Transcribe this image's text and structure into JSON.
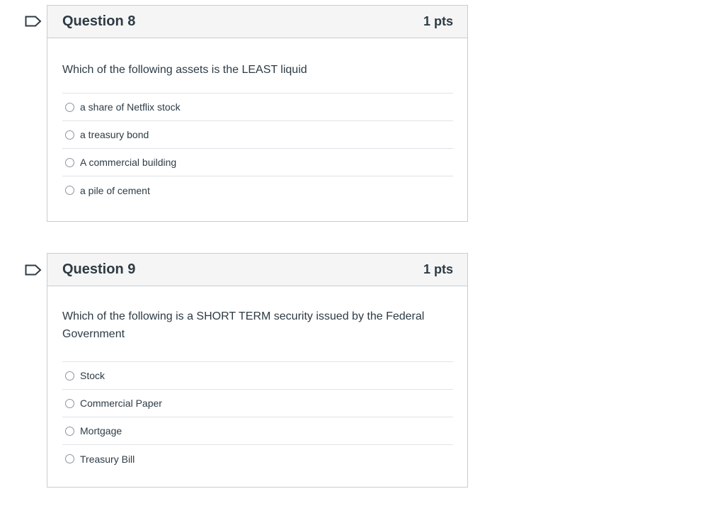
{
  "questions": [
    {
      "title": "Question 8",
      "points": "1 pts",
      "text": "Which of the following assets is the LEAST liquid",
      "answers": [
        "a share of Netflix stock",
        "a treasury bond",
        "A commercial building",
        "a pile of cement"
      ]
    },
    {
      "title": "Question 9",
      "points": "1 pts",
      "text": "Which of the following is a SHORT TERM security issued by the Federal Government",
      "answers": [
        "Stock",
        "Commercial Paper",
        "Mortgage",
        "Treasury Bill"
      ]
    }
  ],
  "colors": {
    "flag": "#2d3b45",
    "border": "#c7cdd1",
    "header_bg": "#f5f5f5",
    "text": "#2d3b45"
  }
}
